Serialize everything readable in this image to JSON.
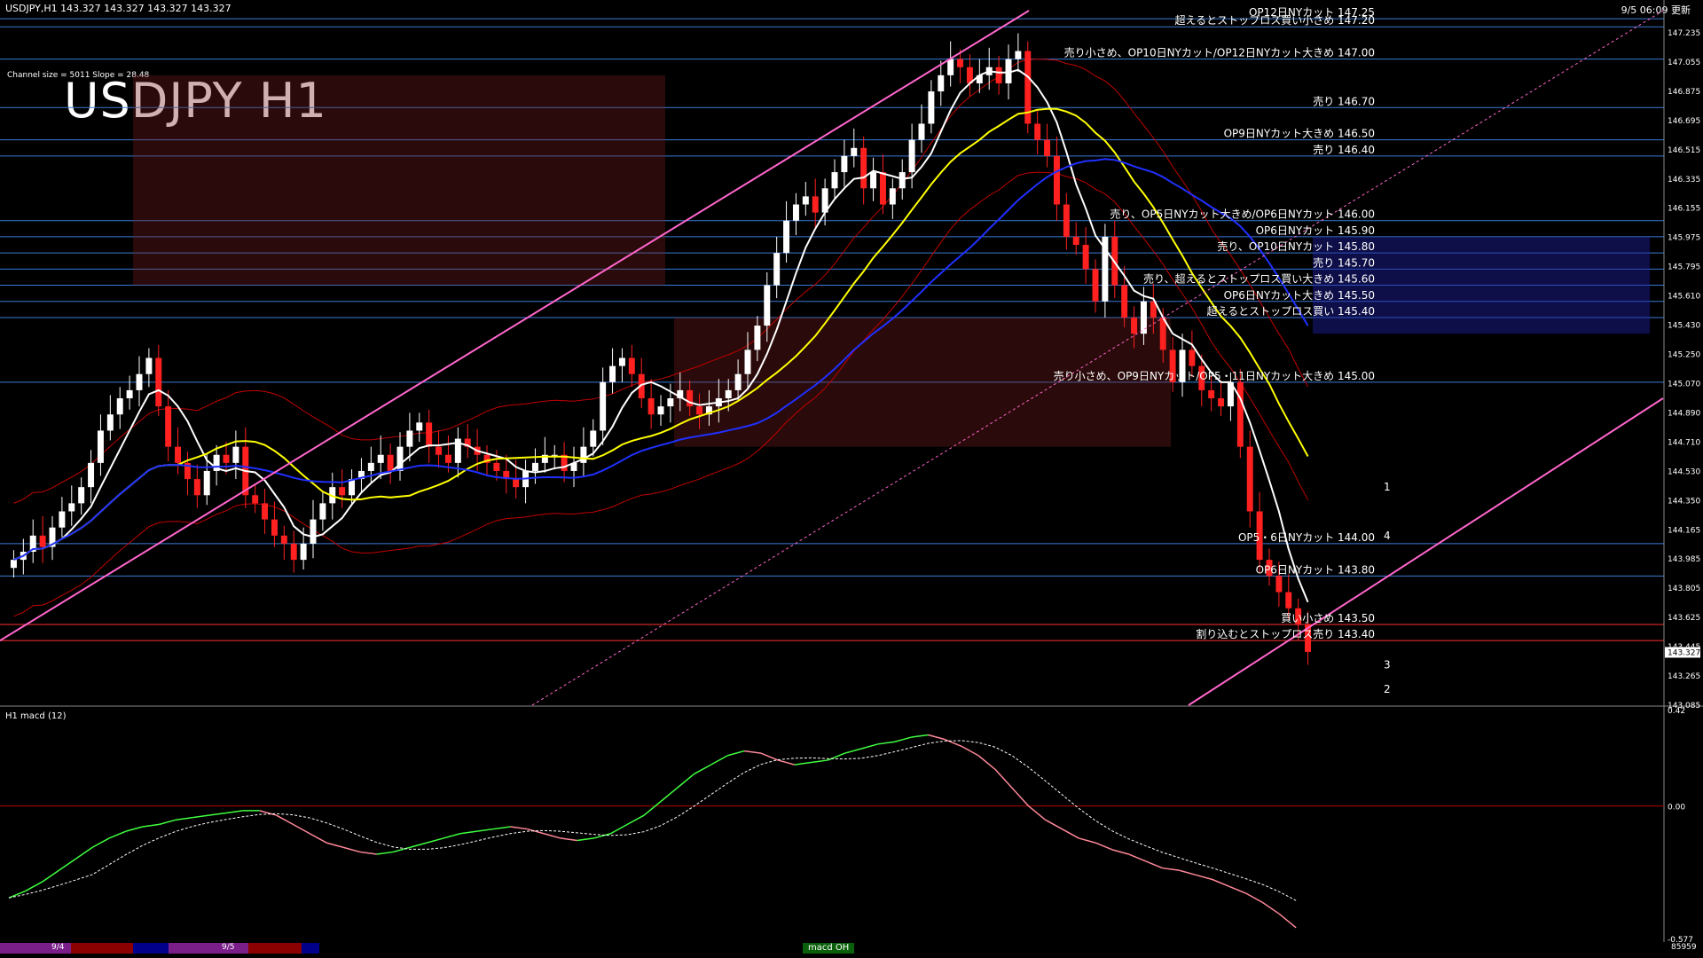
{
  "header": {
    "symbol_info": "USDJPY,H1 143.327 143.327 143.327 143.327",
    "timestamp": "9/5 06:09 更新"
  },
  "title": "USDJPY H1",
  "channel_info": "Channel size = 5011 Slope = 28.48",
  "macd_label": "H1 macd (12)",
  "macd_status": "macd OH",
  "bottom_right": "85959",
  "dates": [
    "9/4",
    "9/5"
  ],
  "colors": {
    "bull": "#ffffff",
    "bear": "#ff2020",
    "level_line": "#3a7bd5",
    "ma_white": "#ffffff",
    "ma_yellow": "#ffff00",
    "ma_blue": "#2030ff",
    "channel": "#ff66cc",
    "macd_up": "#40ff40",
    "macd_down": "#ff8899",
    "signal": "#ffffff"
  },
  "price_axis": {
    "ticks": [
      "147.235",
      "147.055",
      "146.875",
      "146.695",
      "146.515",
      "146.335",
      "146.155",
      "145.975",
      "145.795",
      "145.610",
      "145.430",
      "145.250",
      "145.070",
      "144.890",
      "144.710",
      "144.530",
      "144.350",
      "144.165",
      "143.985",
      "143.805",
      "143.625",
      "143.445",
      "143.265",
      "143.085"
    ],
    "current": "143.327"
  },
  "macd_axis": {
    "top": "0.42",
    "zero": "0.00",
    "bottom": "-0.577"
  },
  "levels": [
    {
      "price": 147.25,
      "label": "OP12日NYカット 147.25"
    },
    {
      "price": 147.2,
      "label": "超えるとストップロス買い小さめ 147.20"
    },
    {
      "price": 147.0,
      "label": "売り小さめ、OP10日NYカット/OP12日NYカット大きめ 147.00"
    },
    {
      "price": 146.7,
      "label": "売り 146.70"
    },
    {
      "price": 146.5,
      "label": "OP9日NYカット大きめ 146.50"
    },
    {
      "price": 146.4,
      "label": "売り 146.40"
    },
    {
      "price": 146.0,
      "label": "売り、OP5日NYカット大きめ/OP6日NYカット 146.00"
    },
    {
      "price": 145.9,
      "label": "OP6日NYカット 145.90"
    },
    {
      "price": 145.8,
      "label": "売り、OP10日NYカット 145.80"
    },
    {
      "price": 145.7,
      "label": "売り 145.70"
    },
    {
      "price": 145.6,
      "label": "売り、超えるとストップロス買い大きめ 145.60"
    },
    {
      "price": 145.5,
      "label": "OP6日NYカット大きめ 145.50"
    },
    {
      "price": 145.4,
      "label": "超えるとストップロス買い 145.40"
    },
    {
      "price": 145.0,
      "label": "売り小さめ、OP9日NYカット/OP5・11日NYカット大きめ 145.00"
    },
    {
      "price": 144.0,
      "label": "OP5・6日NYカット 144.00"
    },
    {
      "price": 143.8,
      "label": "OP6日NYカット 143.80"
    },
    {
      "price": 143.5,
      "label": "買い小さめ 143.50"
    },
    {
      "price": 143.4,
      "label": "割り込むとストップロス売り 143.40"
    }
  ],
  "marks": [
    "1",
    "4",
    "3",
    "2"
  ],
  "chart_data": {
    "type": "candlestick",
    "title": "USDJPY H1",
    "ylim": [
      143.0,
      147.3
    ],
    "macd_ylim": [
      -0.577,
      0.42
    ],
    "close": [
      143.9,
      143.95,
      144.05,
      143.98,
      144.1,
      144.2,
      144.25,
      144.35,
      144.5,
      144.7,
      144.8,
      144.9,
      144.95,
      145.05,
      145.15,
      144.85,
      144.6,
      144.5,
      144.4,
      144.3,
      144.45,
      144.55,
      144.5,
      144.6,
      144.3,
      144.25,
      144.15,
      144.05,
      144.0,
      143.9,
      144.0,
      144.15,
      144.25,
      144.35,
      144.3,
      144.4,
      144.45,
      144.5,
      144.55,
      144.45,
      144.6,
      144.7,
      144.75,
      144.6,
      144.55,
      144.5,
      144.65,
      144.6,
      144.55,
      144.5,
      144.45,
      144.4,
      144.35,
      144.45,
      144.5,
      144.55,
      144.55,
      144.45,
      144.5,
      144.6,
      144.7,
      145.0,
      145.1,
      145.15,
      145.05,
      144.9,
      144.8,
      144.85,
      144.9,
      144.95,
      144.85,
      144.8,
      144.85,
      144.9,
      144.95,
      145.05,
      145.2,
      145.35,
      145.6,
      145.8,
      146.0,
      146.1,
      146.15,
      146.05,
      146.2,
      146.3,
      146.4,
      146.45,
      146.2,
      146.3,
      146.1,
      146.2,
      146.3,
      146.5,
      146.6,
      146.8,
      146.9,
      147.0,
      146.95,
      146.85,
      146.9,
      146.95,
      146.85,
      147.0,
      147.05,
      146.6,
      146.5,
      146.4,
      146.1,
      145.9,
      145.85,
      145.7,
      145.5,
      145.9,
      145.6,
      145.4,
      145.3,
      145.5,
      145.4,
      145.2,
      145.0,
      145.2,
      145.1,
      144.95,
      144.9,
      144.85,
      145.0,
      144.6,
      144.2,
      143.9,
      143.8,
      143.7,
      143.6,
      143.5,
      143.33
    ],
    "macd": [
      -0.4,
      -0.37,
      -0.33,
      -0.28,
      -0.23,
      -0.18,
      -0.14,
      -0.11,
      -0.09,
      -0.08,
      -0.06,
      -0.05,
      -0.04,
      -0.03,
      -0.02,
      -0.02,
      -0.04,
      -0.08,
      -0.12,
      -0.16,
      -0.18,
      -0.2,
      -0.21,
      -0.2,
      -0.18,
      -0.16,
      -0.14,
      -0.12,
      -0.11,
      -0.1,
      -0.09,
      -0.1,
      -0.12,
      -0.14,
      -0.15,
      -0.14,
      -0.12,
      -0.08,
      -0.04,
      0.02,
      0.08,
      0.14,
      0.18,
      0.22,
      0.24,
      0.23,
      0.2,
      0.18,
      0.19,
      0.2,
      0.23,
      0.25,
      0.27,
      0.28,
      0.3,
      0.31,
      0.29,
      0.26,
      0.22,
      0.16,
      0.08,
      0.0,
      -0.06,
      -0.1,
      -0.14,
      -0.16,
      -0.19,
      -0.21,
      -0.24,
      -0.27,
      -0.28,
      -0.3,
      -0.32,
      -0.35,
      -0.38,
      -0.42,
      -0.47,
      -0.53
    ]
  }
}
